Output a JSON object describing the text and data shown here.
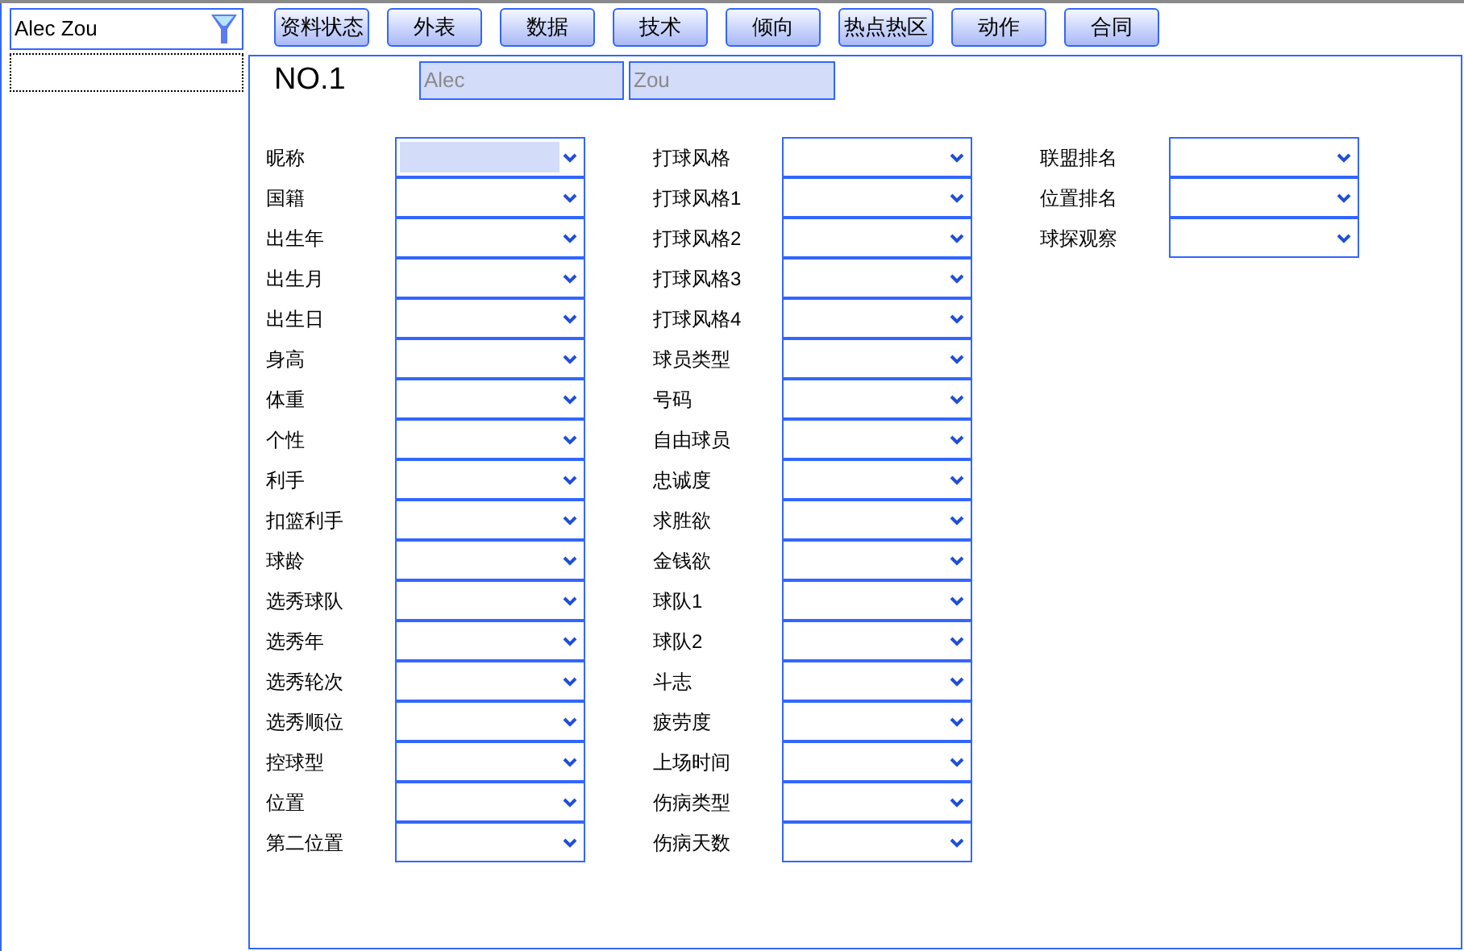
{
  "search": {
    "value": "Alec Zou"
  },
  "player_list": {
    "focused": true
  },
  "tabs": [
    {
      "label": "资料状态",
      "selected": false
    },
    {
      "label": "外表",
      "selected": false
    },
    {
      "label": "数据",
      "selected": false
    },
    {
      "label": "技术",
      "selected": false
    },
    {
      "label": "倾向",
      "selected": false
    },
    {
      "label": "热点热区",
      "selected": false
    },
    {
      "label": "动作",
      "selected": false
    },
    {
      "label": "合同",
      "selected": false
    }
  ],
  "number": "NO.1",
  "first_name": "Alec",
  "last_name": "Zou",
  "columns": [
    [
      {
        "label": "昵称",
        "focused": true
      },
      {
        "label": "国籍",
        "focused": false
      },
      {
        "label": "出生年",
        "focused": false
      },
      {
        "label": "出生月",
        "focused": false
      },
      {
        "label": "出生日",
        "focused": false
      },
      {
        "label": "身高",
        "focused": false
      },
      {
        "label": "体重",
        "focused": false
      },
      {
        "label": "个性",
        "focused": false
      },
      {
        "label": "利手",
        "focused": false
      },
      {
        "label": "扣篮利手",
        "focused": false
      },
      {
        "label": "球龄",
        "focused": false
      },
      {
        "label": "选秀球队",
        "focused": false
      },
      {
        "label": "选秀年",
        "focused": false
      },
      {
        "label": "选秀轮次",
        "focused": false
      },
      {
        "label": "选秀顺位",
        "focused": false
      },
      {
        "label": "控球型",
        "focused": false
      },
      {
        "label": "位置",
        "focused": false
      },
      {
        "label": "第二位置",
        "focused": false
      }
    ],
    [
      {
        "label": "打球风格",
        "focused": false
      },
      {
        "label": "打球风格1",
        "focused": false
      },
      {
        "label": "打球风格2",
        "focused": false
      },
      {
        "label": "打球风格3",
        "focused": false
      },
      {
        "label": "打球风格4",
        "focused": false
      },
      {
        "label": "球员类型",
        "focused": false
      },
      {
        "label": "号码",
        "focused": false
      },
      {
        "label": "自由球员",
        "focused": false
      },
      {
        "label": "忠诚度",
        "focused": false
      },
      {
        "label": "求胜欲",
        "focused": false
      },
      {
        "label": "金钱欲",
        "focused": false
      },
      {
        "label": "球队1",
        "focused": false
      },
      {
        "label": "球队2",
        "focused": false
      },
      {
        "label": "斗志",
        "focused": false
      },
      {
        "label": "疲劳度",
        "focused": false
      },
      {
        "label": "上场时间",
        "focused": false
      },
      {
        "label": "伤病类型",
        "focused": false
      },
      {
        "label": "伤病天数",
        "focused": false
      }
    ],
    [
      {
        "label": "联盟排名",
        "focused": false
      },
      {
        "label": "位置排名",
        "focused": false
      },
      {
        "label": "球探观察",
        "focused": false
      }
    ]
  ]
}
